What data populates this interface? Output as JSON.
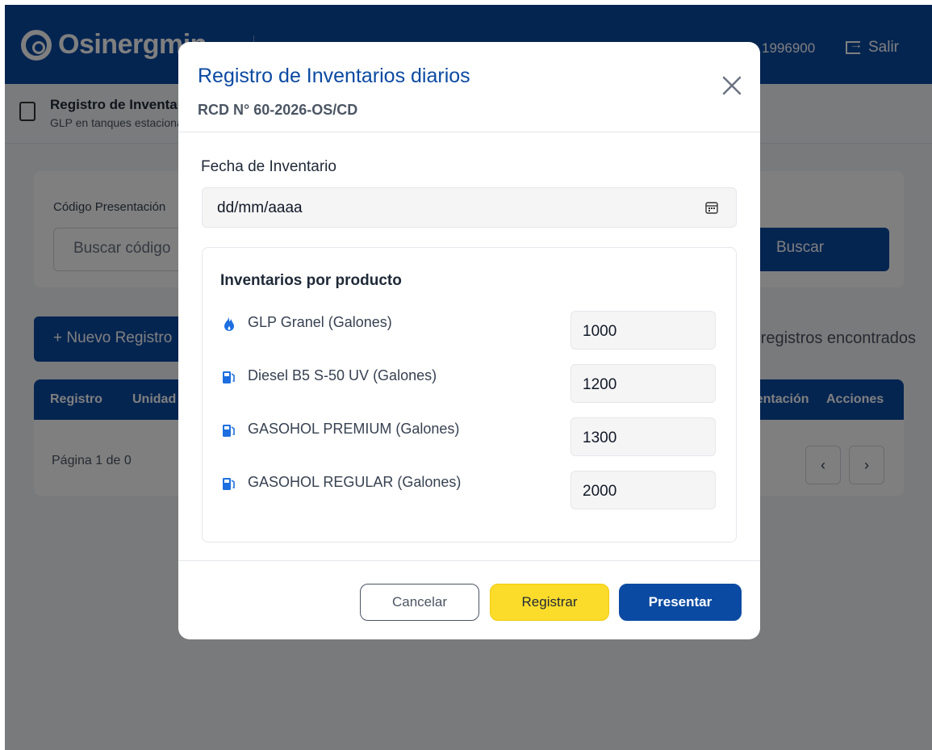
{
  "app": {
    "brand": "Osinergmin",
    "user_code": "1996900",
    "logout_label": "Salir",
    "page_title": "Registro de Inventarios diarios",
    "page_subtitle": "GLP en tanques estacionarios",
    "filter_label": "Código Presentación",
    "filter_placeholder": "Buscar código",
    "search_label": "Buscar",
    "new_label": "+  Nuevo Registro",
    "found_text": "0 registros encontrados",
    "table_headers": [
      "Registro",
      "Unidad",
      "Presentación",
      "Acciones"
    ],
    "pager_text": "Página 1 de 0",
    "prev_label": "‹",
    "next_label": "›"
  },
  "modal": {
    "title": "Registro de Inventarios diarios",
    "subtitle": "RCD N° 60-2026-OS/CD",
    "date_label": "Fecha de Inventario",
    "date_placeholder": "dd/mm/aaaa",
    "panel_title": "Inventarios por producto",
    "products": [
      {
        "icon": "flame-icon",
        "label": "GLP Granel (Galones)",
        "value": "1000"
      },
      {
        "icon": "fuel-pump-icon",
        "label": "Diesel B5 S-50 UV (Galones)",
        "value": "1200"
      },
      {
        "icon": "fuel-pump-icon",
        "label": "GASOHOL PREMIUM (Galones)",
        "value": "1300"
      },
      {
        "icon": "fuel-pump-icon",
        "label": "GASOHOL REGULAR (Galones)",
        "value": "2000"
      }
    ],
    "cancel_label": "Cancelar",
    "register_label": "Registrar",
    "present_label": "Presentar"
  },
  "colors": {
    "brand_blue": "#0b4aa2",
    "register_yellow": "#fcdc2a",
    "overlay": "rgba(0,0,0,0.5)"
  }
}
